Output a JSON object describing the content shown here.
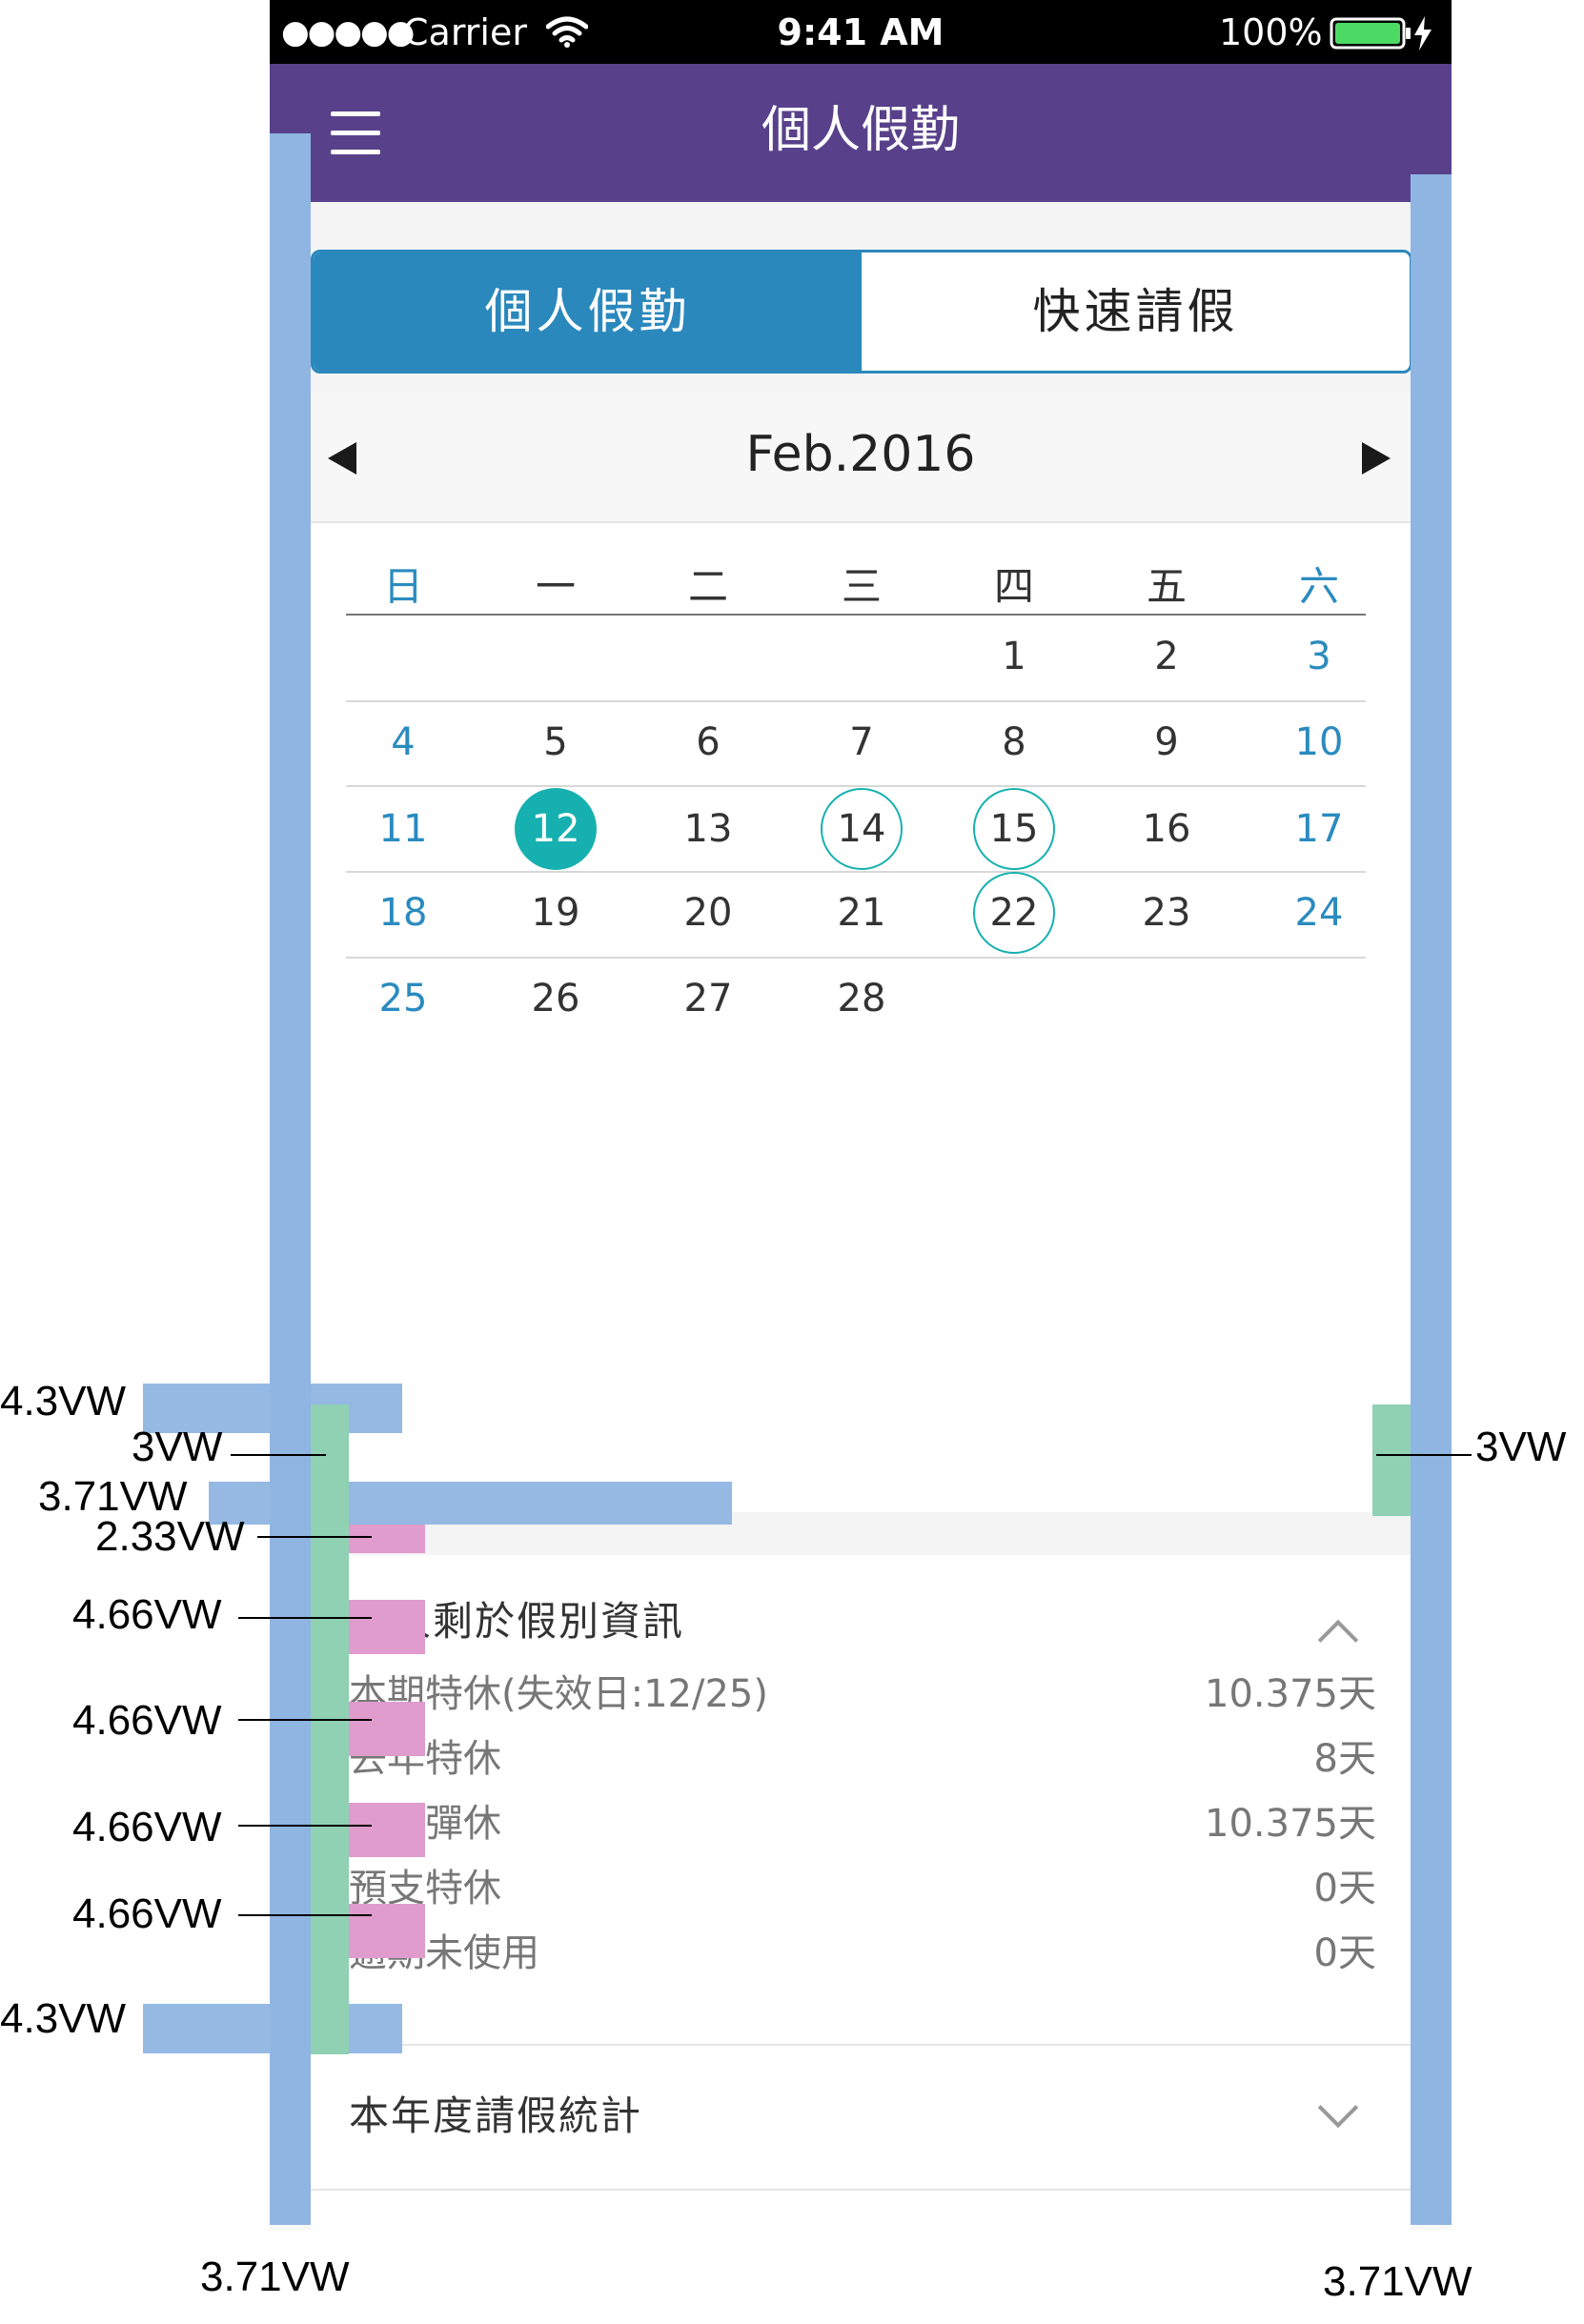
{
  "status_bar": {
    "signal": "●●●●●",
    "carrier": "Carrier",
    "wifi_icon": "wifi-icon",
    "time": "9:41 AM",
    "battery": "100%",
    "battery_icon": "battery-icon",
    "charging_icon": "charging-bolt-icon"
  },
  "nav": {
    "menu_icon": "hamburger-menu-icon",
    "title": "個人假勤"
  },
  "tabs": {
    "left": "個人假勤",
    "right": "快速請假",
    "active": "left"
  },
  "calendar": {
    "month": "Feb.2016",
    "prev_icon": "triangle-left-icon",
    "next_icon": "triangle-right-icon",
    "weekdays": [
      "日",
      "一",
      "二",
      "三",
      "四",
      "五",
      "六"
    ],
    "weeks": [
      [
        "",
        "",
        "",
        "",
        "1",
        "2",
        "3"
      ],
      [
        "4",
        "5",
        "6",
        "7",
        "8",
        "9",
        "10"
      ],
      [
        "11",
        "12",
        "13",
        "14",
        "15",
        "16",
        "17"
      ],
      [
        "18",
        "19",
        "20",
        "21",
        "22",
        "23",
        "24"
      ],
      [
        "25",
        "26",
        "27",
        "28",
        "",
        "",
        ""
      ]
    ],
    "selected_day": "12",
    "marked_days": [
      "14",
      "15",
      "22"
    ],
    "weekend_color": "#2a8bbf",
    "accent_color": "#17b0b0"
  },
  "leave_info": {
    "title": "個人剩於假別資訊",
    "expand_icon": "chevron-up-icon",
    "items": [
      {
        "label": "本期特休(失效日:12/25)",
        "value": "10.375天"
      },
      {
        "label": "去年特休",
        "value": "8天"
      },
      {
        "label": "去年彈休",
        "value": "10.375天"
      },
      {
        "label": "預支特休",
        "value": "0天"
      },
      {
        "label": "逾期未使用",
        "value": "0天"
      }
    ]
  },
  "stats": {
    "title": "本年度請假統計",
    "expand_icon": "chevron-down-icon"
  },
  "annotations": {
    "top_margin": "4.3VW",
    "left_pad": "3VW",
    "right_pad": "3VW",
    "title_gap": "3.71VW",
    "first_gap": "2.33VW",
    "item_gaps": [
      "4.66VW",
      "4.66VW",
      "4.66VW",
      "4.66VW"
    ],
    "bottom_margin": "4.3VW",
    "side_left": "3.71VW",
    "side_right": "3.71VW"
  },
  "colors": {
    "nav": "#58418a",
    "tab_active": "#2b88bd",
    "guide_blue": "#8fb5e2",
    "guide_green": "#8fd1b2",
    "guide_pink": "#df9ccc"
  }
}
